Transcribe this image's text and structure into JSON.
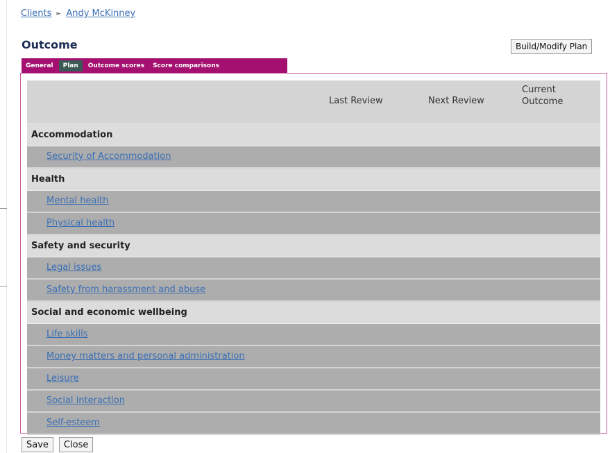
{
  "breadcrumb": {
    "clients": "Clients",
    "separator": "►",
    "client_name": "Andy McKinney"
  },
  "page_title": "Outcome",
  "build_button": "Build/Modify Plan",
  "tabs": [
    {
      "label": "General",
      "active": false
    },
    {
      "label": "Plan",
      "active": true
    },
    {
      "label": "Outcome scores",
      "active": false
    },
    {
      "label": "Score comparisons",
      "active": false
    }
  ],
  "table": {
    "headers": {
      "last_review": "Last Review",
      "next_review": "Next Review",
      "current_outcome": "Current Outcome"
    },
    "groups": [
      {
        "name": "Accommodation",
        "items": [
          "Security of Accommodation"
        ]
      },
      {
        "name": "Health",
        "items": [
          "Mental health",
          "Physical health"
        ]
      },
      {
        "name": "Safety and security",
        "items": [
          "Legal issues",
          "Safety from harassment and abuse"
        ]
      },
      {
        "name": "Social and economic wellbeing",
        "items": [
          "Life skills",
          "Money matters and personal administration",
          "Leisure",
          "Social interaction",
          "Self-esteem"
        ]
      }
    ]
  },
  "footer": {
    "save": "Save",
    "close": "Close"
  }
}
